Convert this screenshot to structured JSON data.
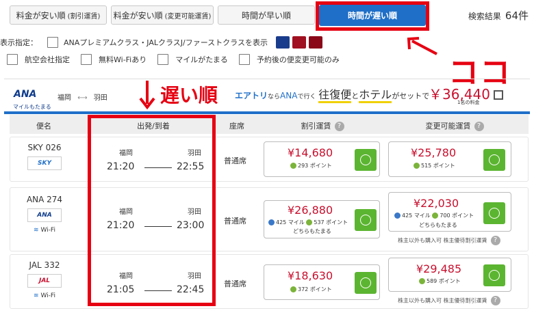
{
  "tabs": [
    {
      "label": "料金が安い順",
      "sub": "(割引運賃)"
    },
    {
      "label": "料金が安い順",
      "sub": "(変更可能運賃)"
    },
    {
      "label": "時間が早い順",
      "sub": ""
    },
    {
      "label": "時間が遅い順",
      "sub": ""
    }
  ],
  "result": {
    "label": "検索結果",
    "count": "64件"
  },
  "filters": {
    "display_label": "表示指定：",
    "premium_label": "ANAプレミアムクラス・JALクラスJ/ファーストクラスを表示",
    "options": [
      "航空会社指定",
      "無料Wi-Fiあり",
      "マイルがたまる",
      "予約後の便変更可能のみ"
    ]
  },
  "annotations": {
    "koko": "ココ",
    "osoi": "遅い順"
  },
  "route": {
    "logo": "ANA",
    "logo_sub": "マイルもたまる",
    "from": "福岡",
    "arrow": "⟷",
    "to": "羽田",
    "promo_brand": "エアトリ",
    "promo_1": "なら",
    "promo_ana": "ANA",
    "promo_2": "で行く",
    "promo_trip": "往復便",
    "promo_and": "と",
    "promo_hotel": "ホテル",
    "promo_3": "がセットで",
    "price": "￥36,440",
    "price_note": "1名の料金"
  },
  "table_header": {
    "flight": "便名",
    "times": "出発/到着",
    "seat": "座席",
    "discount": "割引運賃",
    "changeable": "変更可能運賃"
  },
  "rows": [
    {
      "flight_no": "SKY 026",
      "airline_logo": "SKY",
      "wifi": "",
      "dep_city": "福岡",
      "arr_city": "羽田",
      "dep_time": "21:20",
      "arr_time": "22:55",
      "seat": "普通席",
      "discount_price": "¥14,680",
      "discount_points": "293 ポイント",
      "discount_miles": "",
      "discount_both": "",
      "change_price": "¥25,780",
      "change_points": "515 ポイント",
      "change_miles": "",
      "change_both": "",
      "note": ""
    },
    {
      "flight_no": "ANA 274",
      "airline_logo": "ANA",
      "wifi": "Wi-Fi",
      "dep_city": "福岡",
      "arr_city": "羽田",
      "dep_time": "21:20",
      "arr_time": "23:00",
      "seat": "普通席",
      "discount_price": "¥26,880",
      "discount_points": "537 ポイント",
      "discount_miles": "425 マイル",
      "discount_both": "どちらもたまる",
      "change_price": "¥22,030",
      "change_points": "700 ポイント",
      "change_miles": "425 マイル",
      "change_both": "どちらもたまる",
      "note": "株主以外も購入可 株主優待割引運賃"
    },
    {
      "flight_no": "JAL 332",
      "airline_logo": "JAL",
      "wifi": "Wi-Fi",
      "dep_city": "福岡",
      "arr_city": "羽田",
      "dep_time": "21:05",
      "arr_time": "22:45",
      "seat": "普通席",
      "discount_price": "¥18,630",
      "discount_points": "372 ポイント",
      "discount_miles": "",
      "discount_both": "",
      "change_price": "¥29,485",
      "change_points": "589 ポイント",
      "change_miles": "",
      "change_both": "",
      "note": "株主以外も購入可 株主優待割引運賃"
    }
  ],
  "colors": {
    "accent": "#1f6fc8",
    "highlight": "#e60012",
    "price": "#c8102e",
    "button": "#5cb531"
  }
}
